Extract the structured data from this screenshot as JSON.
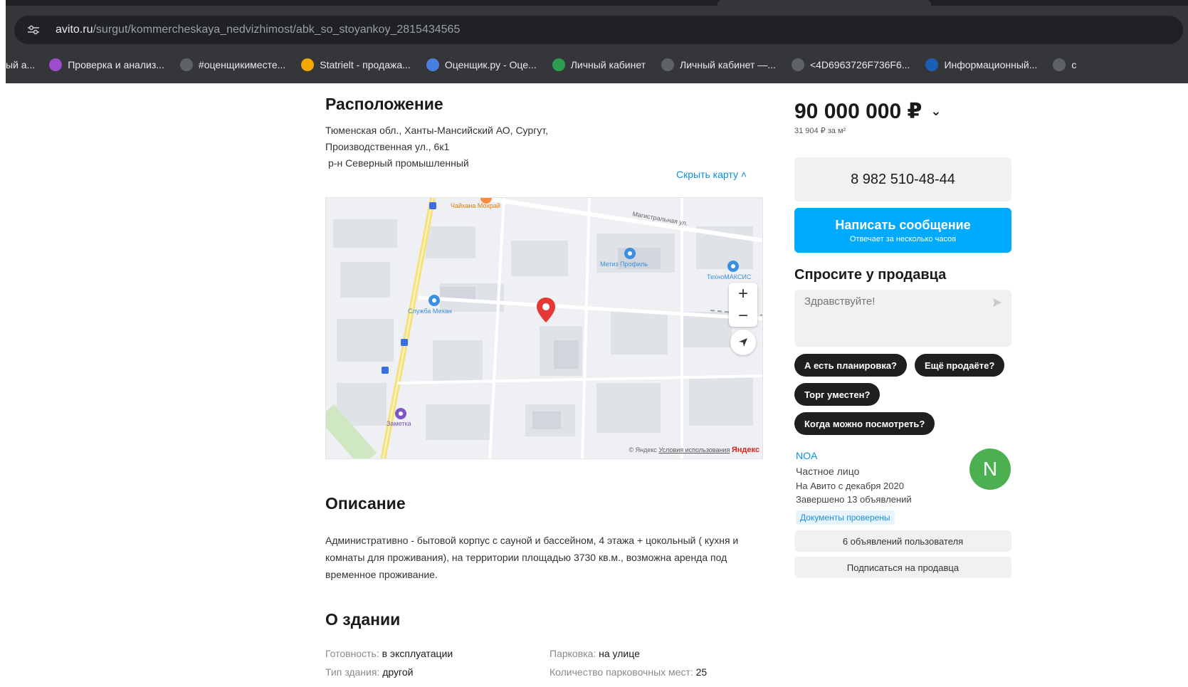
{
  "browser": {
    "url_domain": "avito.ru",
    "url_path": "/surgut/kommercheskaya_nedvizhimost/abk_so_stoyankoy_2815434565",
    "bookmarks": [
      {
        "label": "ый а...",
        "icon": "globe-icon"
      },
      {
        "label": "Проверка и анализ...",
        "icon": "purple-circle-icon"
      },
      {
        "label": "#оценщикиместе...",
        "icon": "globe-icon"
      },
      {
        "label": "Statrielt - продажа...",
        "icon": "statrielt-icon"
      },
      {
        "label": "Оценщик.ру - Оце...",
        "icon": "snowflake-icon"
      },
      {
        "label": "Личный кабинет",
        "icon": "shield-icon"
      },
      {
        "label": "Личный кабинет —...",
        "icon": "globe-icon"
      },
      {
        "label": "<4D6963726F736F6...",
        "icon": "globe-icon"
      },
      {
        "label": "Информационный...",
        "icon": "doc-icon"
      },
      {
        "label": "с",
        "icon": "globe-icon"
      }
    ]
  },
  "location": {
    "title": "Расположение",
    "address_line1": "Тюменская обл., Ханты-Мансийский АО, Сургут,",
    "address_line2": "Производственная ул., 6к1",
    "district": "р-н Северный промышленный",
    "hide_map": "Скрыть карту ˄"
  },
  "map": {
    "labels": {
      "street": "Магистральная ул.",
      "poi1": "Метиз Профиль",
      "poi2": "ТехноМАКСИС",
      "poi3": "Служба Механ",
      "poi4": "Заметка",
      "poi5": "Чайхана Мохрай"
    },
    "footer_copyright": "© Яндекс",
    "footer_terms": "Условия использования",
    "footer_brand": "Яндекс",
    "zoom_in": "+",
    "zoom_out": "−"
  },
  "description": {
    "title": "Описание",
    "text": "Административно - бытовой корпус с сауной и бассейном, 4 этажа + цокольный ( кухня и комнаты для проживания), на территории площадью 3730 кв.м., возможна аренда под временное проживание."
  },
  "building": {
    "title": "О здании",
    "params": [
      {
        "key": "Готовность:",
        "value": "в эксплуатации"
      },
      {
        "key": "Тип здания:",
        "value": "другой"
      },
      {
        "key": "Парковка:",
        "value": "на улице"
      },
      {
        "key": "Количество парковочных мест:",
        "value": "25"
      }
    ]
  },
  "sidebar": {
    "price": "90 000 000 ₽",
    "price_per_m": "31 904 ₽ за м²",
    "phone": "8 982 510-48-44",
    "message_button": "Написать сообщение",
    "message_sub": "Отвечает за несколько часов",
    "ask_title": "Спросите у продавца",
    "ask_placeholder": "Здравствуйте!",
    "chips": [
      "А есть планировка?",
      "Ещё продаёте?",
      "Торг уместен?",
      "Когда можно посмотреть?"
    ],
    "seller": {
      "name": "NOA",
      "type": "Частное лицо",
      "since": "На Авито с декабря 2020",
      "completed": "Завершено 13 объявлений",
      "docs": "Документы проверены",
      "avatar_letter": "N"
    },
    "user_ads_button": "6 объявлений пользователя",
    "subscribe_button": "Подписаться на продавца"
  },
  "colors": {
    "accent_blue": "#00aaff",
    "link_blue": "#0a8fdf",
    "avatar_green": "#4caf50",
    "map_pin": "#e53935"
  }
}
